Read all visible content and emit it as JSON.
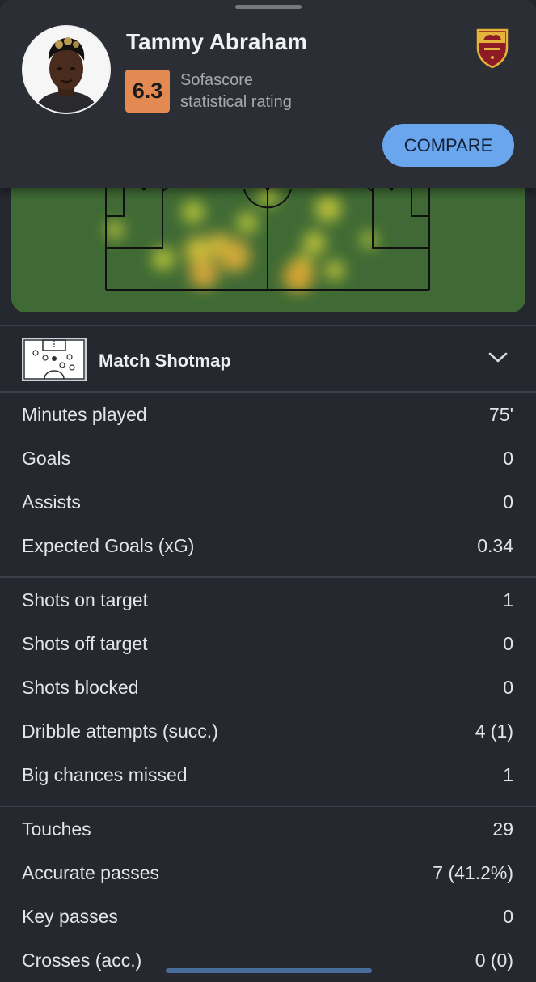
{
  "player": {
    "name": "Tammy Abraham",
    "rating": "6.3",
    "rating_label_line1": "Sofascore",
    "rating_label_line2": "statistical rating",
    "rating_color": "#e28a52",
    "club_logo_icon": "as-roma-crest-icon"
  },
  "compare_button": {
    "label": "COMPARE",
    "color": "#6aa6ee"
  },
  "heatmap": {
    "icon": "heatmap",
    "pitch_color": "#3f6a35"
  },
  "shotmap": {
    "title": "Match Shotmap",
    "icon": "pitch-icon",
    "expand_icon": "chevron-down-icon"
  },
  "groups": [
    {
      "stats": [
        {
          "label": "Minutes played",
          "value": "75'"
        },
        {
          "label": "Goals",
          "value": "0"
        },
        {
          "label": "Assists",
          "value": "0"
        },
        {
          "label": "Expected Goals (xG)",
          "value": "0.34"
        }
      ]
    },
    {
      "stats": [
        {
          "label": "Shots on target",
          "value": "1"
        },
        {
          "label": "Shots off target",
          "value": "0"
        },
        {
          "label": "Shots blocked",
          "value": "0"
        },
        {
          "label": "Dribble attempts (succ.)",
          "value": "4 (1)"
        },
        {
          "label": "Big chances missed",
          "value": "1"
        }
      ]
    },
    {
      "stats": [
        {
          "label": "Touches",
          "value": "29"
        },
        {
          "label": "Accurate passes",
          "value": "7 (41.2%)"
        },
        {
          "label": "Key passes",
          "value": "0"
        },
        {
          "label": "Crosses (acc.)",
          "value": "0 (0)"
        }
      ]
    }
  ]
}
